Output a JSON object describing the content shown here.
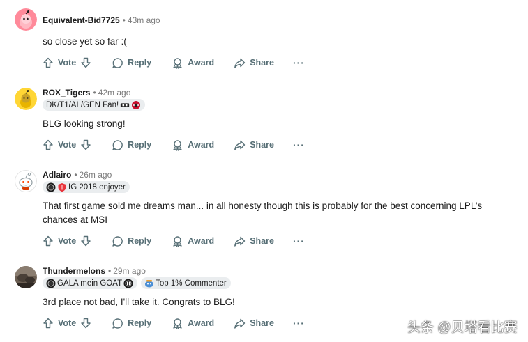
{
  "comments": [
    {
      "author": "Equivalent-Bid7725",
      "time": "43m ago",
      "flairs": [],
      "body": "so close yet so far :(",
      "avatar_color": "#ff8a9a",
      "actions": {
        "vote": "Vote",
        "reply": "Reply",
        "award": "Award",
        "share": "Share",
        "more": "···"
      }
    },
    {
      "author": "ROX_Tigers",
      "time": "42m ago",
      "flairs": [
        {
          "text": "DK/T1/AL/GEN Fan!",
          "emojis_after": [
            "team-logo-icon",
            "team-logo-icon"
          ]
        }
      ],
      "body": "BLG looking strong!",
      "avatar_color": "#ffd635",
      "actions": {
        "vote": "Vote",
        "reply": "Reply",
        "award": "Award",
        "share": "Share",
        "more": "···"
      }
    },
    {
      "author": "Adlairo",
      "time": "26m ago",
      "flairs": [
        {
          "text": "IG 2018 enjoyer",
          "emojis_before": [
            "ig-logo-icon",
            "shield-icon"
          ]
        }
      ],
      "body": "That first game sold me dreams man... in all honesty though this is probably for the best concerning LPL’s chances at MSI",
      "avatar_color": "#ffffff",
      "actions": {
        "vote": "Vote",
        "reply": "Reply",
        "award": "Award",
        "share": "Share",
        "more": "···"
      }
    },
    {
      "author": "Thundermelons",
      "time": "29m ago",
      "flairs": [
        {
          "text": "GALA mein GOAT",
          "emojis_before": [
            "ig-logo-icon"
          ],
          "emojis_after": [
            "ig-logo-icon"
          ]
        },
        {
          "text": "Top 1% Commenter",
          "emojis_before": [
            "top-commenter-icon"
          ]
        }
      ],
      "body": "3rd place not bad, I'll take it. Congrats to BLG!",
      "avatar_color": "#6b5e52",
      "actions": {
        "vote": "Vote",
        "reply": "Reply",
        "award": "Award",
        "share": "Share",
        "more": "···"
      }
    }
  ],
  "watermark": "头条 @贝塔看比赛",
  "colors": {
    "action_gray": "#576f76",
    "meta_gray": "#7c7c7c",
    "flair_bg": "#eaedef"
  }
}
